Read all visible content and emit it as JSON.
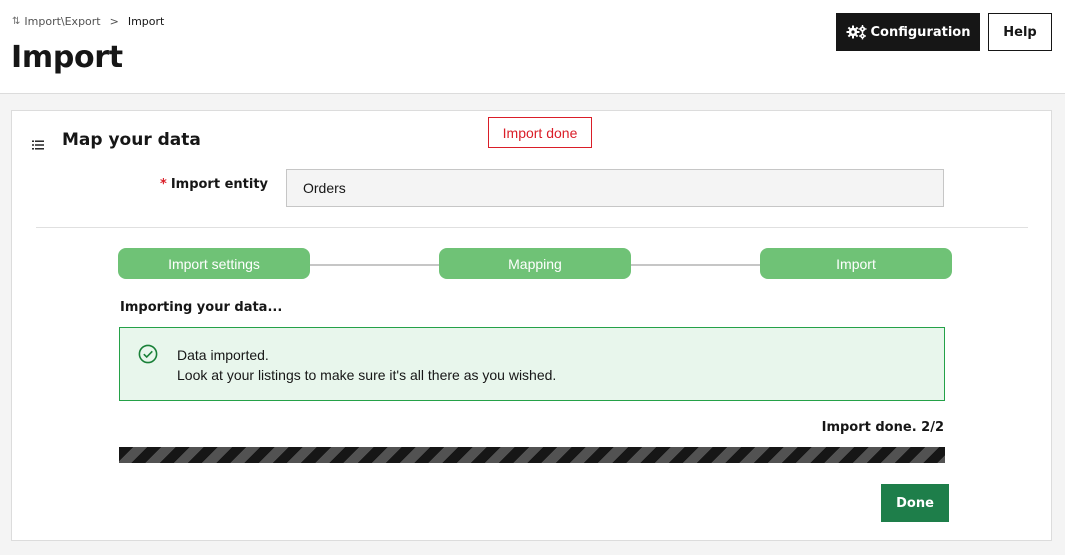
{
  "header": {
    "breadcrumb": {
      "parent": "Import\\Export",
      "separator": ">",
      "current": "Import"
    },
    "title": "Import",
    "configuration_label": "Configuration",
    "help_label": "Help"
  },
  "toast": {
    "message": "Import done"
  },
  "section": {
    "title": "Map your data",
    "entity": {
      "required_marker": "*",
      "label": "Import entity",
      "value": "Orders"
    },
    "steps": [
      {
        "label": "Import settings",
        "state": "completed"
      },
      {
        "label": "Mapping",
        "state": "completed"
      },
      {
        "label": "Import",
        "state": "completed"
      }
    ],
    "status_heading": "Importing your data...",
    "notification": {
      "line1": "Data imported.",
      "line2": "Look at your listings to make sure it's all there as you wished."
    },
    "progress": {
      "label": "Import done. 2/2",
      "fraction": 1.0
    },
    "done_label": "Done"
  },
  "colors": {
    "step_completed": "#6fc276",
    "success_border": "#24a148",
    "success_bg": "#e8f6ec",
    "done_button": "#1e7e4a",
    "toast_border": "#da1e28",
    "primary_dark": "#161616"
  },
  "icons": {
    "breadcrumb": "import-export-icon",
    "configuration": "gears-icon",
    "section": "list-icon",
    "notification": "checkmark-circle-icon"
  }
}
